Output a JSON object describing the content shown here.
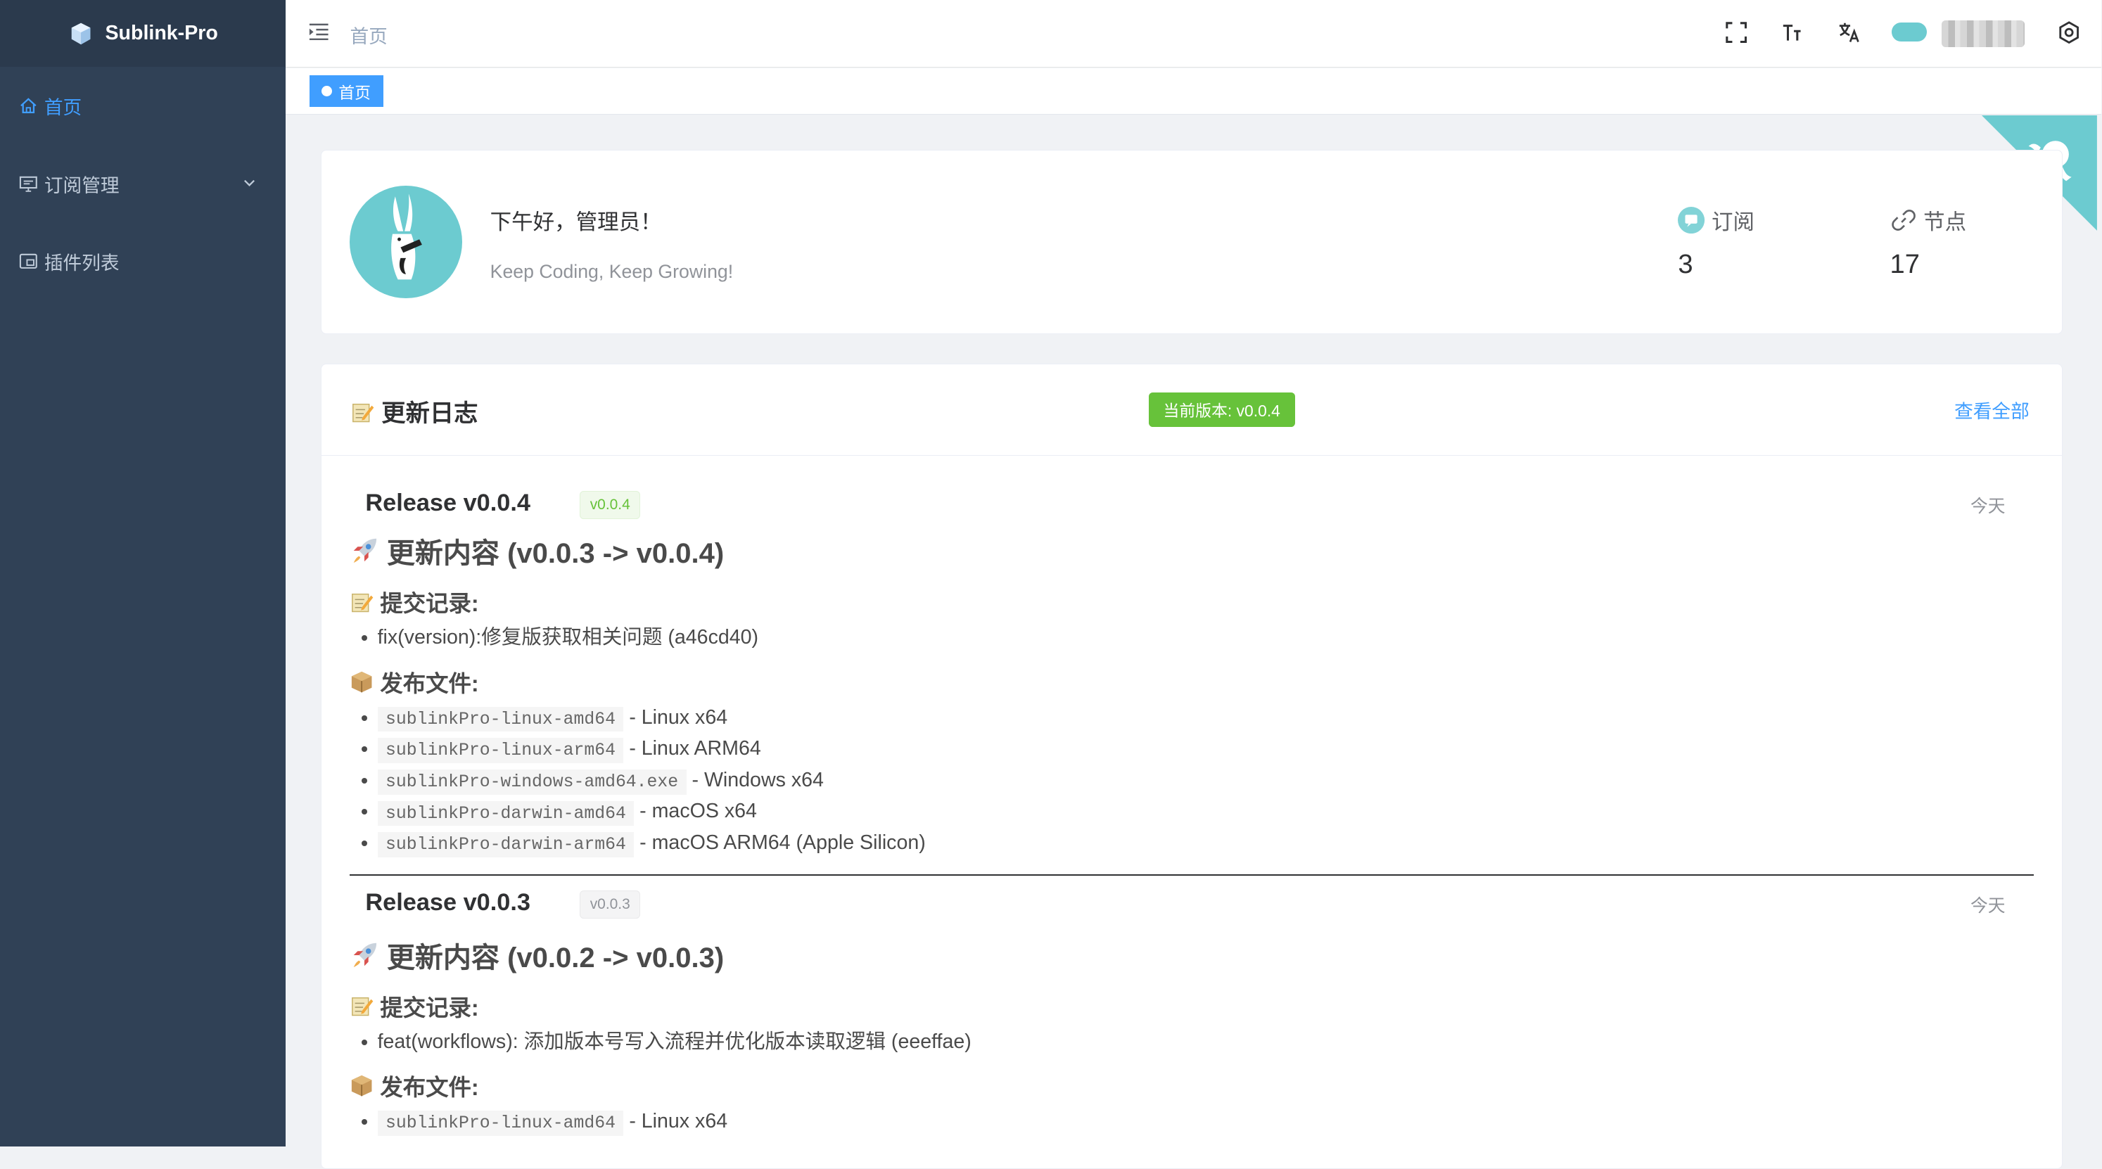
{
  "app": {
    "name": "Sublink-Pro"
  },
  "sidebar": {
    "items": [
      {
        "label": "首页",
        "icon": "home-icon",
        "active": true
      },
      {
        "label": "订阅管理",
        "icon": "monitor-icon",
        "expandable": true
      },
      {
        "label": "插件列表",
        "icon": "plugin-icon"
      }
    ]
  },
  "header": {
    "breadcrumb": "首页",
    "icons": [
      "fullscreen-icon",
      "font-size-icon",
      "translate-icon",
      "settings-icon"
    ]
  },
  "tags": [
    {
      "label": "首页",
      "active": true
    }
  ],
  "welcome": {
    "greeting": "下午好，管理员！",
    "motto": "Keep Coding, Keep Growing!",
    "stats": [
      {
        "label": "订阅",
        "value": "3",
        "icon": "subscription-icon"
      },
      {
        "label": "节点",
        "value": "17",
        "icon": "link-icon"
      }
    ]
  },
  "changelog": {
    "title": "更新日志",
    "current_version": "当前版本: v0.0.4",
    "view_all": "查看全部",
    "releases": [
      {
        "title": "Release v0.0.4",
        "tag": "v0.0.4",
        "date": "今天",
        "heading": "更新内容 (v0.0.3 -> v0.0.4)",
        "commits_label": "提交记录:",
        "commits": [
          "fix(version):修复版获取相关问题 (a46cd40)"
        ],
        "files_label": "发布文件:",
        "files": [
          {
            "name": "sublinkPro-linux-amd64",
            "desc": " - Linux x64"
          },
          {
            "name": "sublinkPro-linux-arm64",
            "desc": " - Linux ARM64"
          },
          {
            "name": "sublinkPro-windows-amd64.exe",
            "desc": " - Windows x64"
          },
          {
            "name": "sublinkPro-darwin-amd64",
            "desc": " - macOS x64"
          },
          {
            "name": "sublinkPro-darwin-arm64",
            "desc": " - macOS ARM64 (Apple Silicon)"
          }
        ]
      },
      {
        "title": "Release v0.0.3",
        "tag": "v0.0.3",
        "date": "今天",
        "heading": "更新内容 (v0.0.2 -> v0.0.3)",
        "commits_label": "提交记录:",
        "commits": [
          "feat(workflows): 添加版本号写入流程并优化版本读取逻辑 (eeeffae)"
        ],
        "files_label": "发布文件:",
        "files": [
          {
            "name": "sublinkPro-linux-amd64",
            "desc": " - Linux x64"
          }
        ]
      }
    ]
  },
  "colors": {
    "sidebar_bg": "#304156",
    "accent": "#409eff",
    "success": "#67c23a",
    "avatar_bg": "#6ccbd0"
  }
}
